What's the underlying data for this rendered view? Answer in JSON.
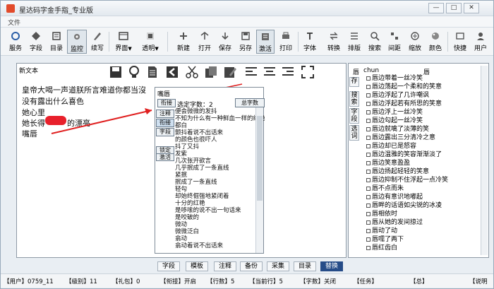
{
  "window": {
    "title": "星达码字金手指_专业版",
    "minimize": "—",
    "restore": "□",
    "close": "✕"
  },
  "menu": {
    "items": [
      "文件"
    ]
  },
  "toolbar": {
    "buttons": [
      {
        "label": "服务",
        "icon": "service-icon"
      },
      {
        "label": "字段",
        "icon": "field-icon"
      },
      {
        "label": "目录",
        "icon": "catalog-icon"
      },
      {
        "label": "监控",
        "icon": "monitor-icon"
      },
      {
        "label": "续写",
        "icon": "continue-write-icon"
      },
      {
        "label": "界面",
        "icon": "interface-icon"
      },
      {
        "label": "透明",
        "icon": "transparent-icon"
      },
      {
        "label": "新建",
        "icon": "new-icon"
      },
      {
        "label": "打开",
        "icon": "open-icon"
      },
      {
        "label": "保存",
        "icon": "save-icon"
      },
      {
        "label": "另存",
        "icon": "save-as-icon"
      },
      {
        "label": "激活",
        "icon": "activate-icon"
      },
      {
        "label": "打印",
        "icon": "print-icon"
      },
      {
        "label": "字体",
        "icon": "font-icon"
      },
      {
        "label": "转换",
        "icon": "convert-icon"
      },
      {
        "label": "排版",
        "icon": "layout-icon"
      },
      {
        "label": "搜索",
        "icon": "search-icon"
      },
      {
        "label": "间距",
        "icon": "spacing-icon"
      },
      {
        "label": "缩放",
        "icon": "zoom-icon"
      },
      {
        "label": "颜色",
        "icon": "color-icon"
      },
      {
        "label": "快捷",
        "icon": "shortcut-icon"
      },
      {
        "label": "用户",
        "icon": "user-icon"
      }
    ]
  },
  "editor": {
    "doc_label": "新文本",
    "lines": [
      "皇帝大喝一声道朕所言难道你都当沒",
      "没有露出什么喜色",
      "她心里",
      "她长得",
      "的漂亮",
      "嘴唇"
    ]
  },
  "popup": {
    "head": "嘴唇",
    "buttons": [
      "衔接",
      "注释",
      "衔接",
      "字段",
      "锁定",
      "激活"
    ],
    "choose_label": "选定字数：2",
    "total_button": "总字数",
    "candidates": [
      "便会微微的发抖",
      "不知为什么有一种鲜血一样的红艳",
      "都白",
      "颤抖着说不出话来",
      "的颜色也很吓人",
      "抖了又抖",
      "发紫",
      "几次张开欲言",
      "几乎抿成了一条直线",
      "紧抿",
      "抿成了一条直线",
      "轻勾",
      "却始终倔强地紧闭着",
      "十分的红艳",
      "是哆嗦的说不出一句话来",
      "是咬破的",
      "微动",
      "微微泛白",
      "翕动",
      "翕动着说不出话来"
    ]
  },
  "rightpanel": {
    "head_left": "唇",
    "head_pinyin": "chun",
    "head_char": "唇",
    "tabs": [
      "存",
      "搜索",
      "字段",
      "选词"
    ],
    "items": [
      "唇边带着一丝冷笑",
      "唇边荡起一个柔和的笑意",
      "唇边浮起了几许嘲讽",
      "唇边浮起若有所思的笑意",
      "唇边浮上一丝冷笑",
      "唇边勾起一丝冷笑",
      "唇边就噙了淡薄的笑",
      "唇边露出三分清冷之意",
      "唇边却已是怒容",
      "唇边温雅的笑容渐渐淡了",
      "唇边笑意盈盈",
      "唇边扬起轻轻的笑意",
      "唇边抑制不住浮起一点冷笑",
      "唇不点而朱",
      "唇边有意识地嘟起",
      "唇畔的话语如尖锐的冰凌",
      "唇相依时",
      "唇从她的发间掠过",
      "唇动了动",
      "唇嚅了两下",
      "唇红齿白"
    ]
  },
  "bottom_tabs": [
    "字段",
    "模板",
    "注释",
    "备份",
    "采集",
    "目录",
    "替换"
  ],
  "status": [
    "【用户】0759_11",
    "【级别】11",
    "【礼包】0",
    "【衔接】开启",
    "【行数】5",
    "【当前行】5",
    "【字数】关闭",
    "【任务】",
    "【总】",
    "【说明"
  ]
}
